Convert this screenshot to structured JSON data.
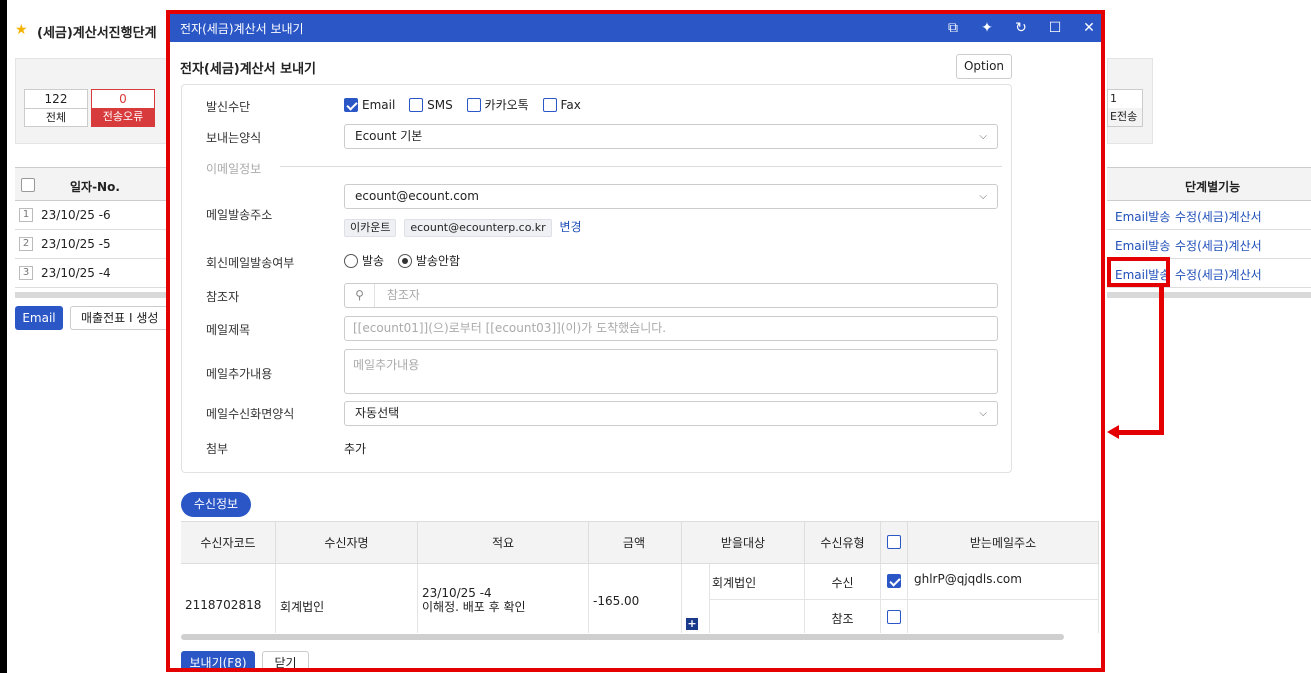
{
  "background": {
    "page_title": "(세금)계산서진행단계",
    "counts": [
      {
        "value": "122",
        "label": "전체"
      },
      {
        "value": "0",
        "label": "전송오류"
      }
    ],
    "right_count": {
      "value": "1",
      "label": "E전송"
    },
    "grid": {
      "date_header": "일자-No.",
      "rows": [
        {
          "num": "1",
          "date": "23/10/25 -6"
        },
        {
          "num": "2",
          "date": "23/10/25 -5"
        },
        {
          "num": "3",
          "date": "23/10/25 -4"
        }
      ],
      "stage_header": "단계별기능",
      "stage_rows": [
        {
          "a": "Email발송",
          "b": "수정(세금)계산서"
        },
        {
          "a": "Email발송",
          "b": "수정(세금)계산서"
        },
        {
          "a": "Email발송",
          "b": "수정(세금)계산서"
        }
      ]
    },
    "buttons": {
      "email": "Email",
      "sales": "매출전표 I 생성"
    }
  },
  "modal": {
    "window_title": "전자(세금)계산서 보내기",
    "heading": "전자(세금)계산서 보내기",
    "option_button": "Option",
    "form": {
      "send_method_label": "발신수단",
      "send_methods": [
        {
          "label": "Email",
          "checked": true
        },
        {
          "label": "SMS",
          "checked": false
        },
        {
          "label": "카카오톡",
          "checked": false
        },
        {
          "label": "Fax",
          "checked": false
        }
      ],
      "send_format_label": "보내는양식",
      "send_format_value": "Ecount 기본",
      "email_section_label": "이메일정보",
      "sender_address_label": "메일발송주소",
      "sender_address_value": "ecount@ecount.com",
      "sender_name_chip": "이카운트",
      "sender_email_chip": "ecount@ecounterp.co.kr",
      "change_link": "변경",
      "reply_label": "회신메일발송여부",
      "reply_send": "발송",
      "reply_nosend": "발송안함",
      "cc_label": "참조자",
      "cc_placeholder": "참조자",
      "subject_label": "메일제목",
      "subject_placeholder": "[[ecount01]](으)로부터 [[ecount03]](이)가 도착했습니다.",
      "extra_label": "메일추가내용",
      "extra_placeholder": "메일추가내용",
      "receive_format_label": "메일수신화면양식",
      "receive_format_value": "자동선택",
      "attach_label": "첨부",
      "attach_link": "추가"
    },
    "recipient_button": "수신정보",
    "table": {
      "headers": {
        "code": "수신자코드",
        "name": "수신자명",
        "memo": "적요",
        "amount": "금액",
        "target": "받을대상",
        "type": "수신유형",
        "email": "받는메일주소"
      },
      "row": {
        "code": "2118702818",
        "name": "회계법인",
        "memo_line1": "23/10/25 -4",
        "memo_line2": "이해정. 배포 후 확인",
        "amount": "-165.00",
        "target1": "회계법인",
        "type1": "수신",
        "email1": "ghlrP@qjqdls.com",
        "type2": "참조"
      }
    },
    "send_button": "보내기(F8)",
    "close_button": "닫기"
  },
  "colors": {
    "accent": "#2a56c6",
    "highlight": "#e40000",
    "error": "#d83b3b"
  }
}
